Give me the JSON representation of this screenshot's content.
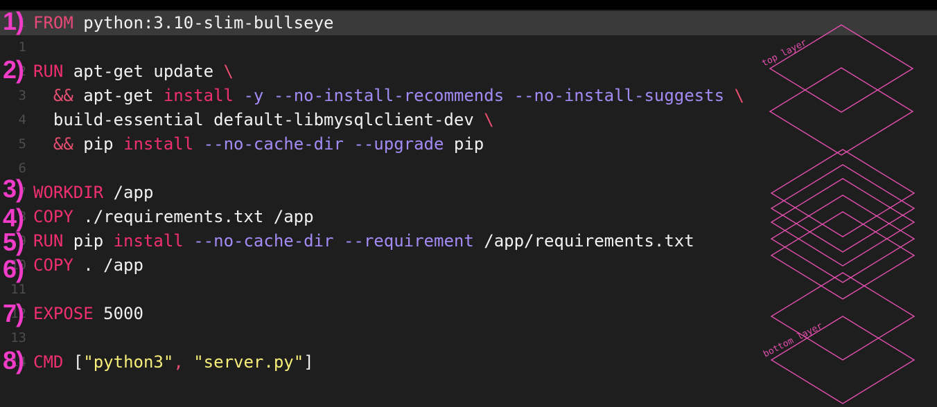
{
  "editor": {
    "lines": [
      {
        "num": "1",
        "tokens": [
          {
            "t": "FROM",
            "c": "kw-dim"
          },
          {
            "t": " python:3.10-slim-bullseye",
            "c": ""
          }
        ]
      },
      {
        "num": "1",
        "tokens": []
      },
      {
        "num": "2",
        "tokens": [
          {
            "t": "RUN",
            "c": "kw"
          },
          {
            "t": " apt-get update ",
            "c": ""
          },
          {
            "t": "\\",
            "c": "op"
          }
        ]
      },
      {
        "num": "3",
        "tokens": [
          {
            "t": "  ",
            "c": ""
          },
          {
            "t": "&&",
            "c": "op"
          },
          {
            "t": " apt-get ",
            "c": ""
          },
          {
            "t": "install",
            "c": "kw"
          },
          {
            "t": " ",
            "c": ""
          },
          {
            "t": "-y --no-install-recommends --no-install-suggests",
            "c": "flag"
          },
          {
            "t": " ",
            "c": ""
          },
          {
            "t": "\\",
            "c": "op"
          }
        ]
      },
      {
        "num": "4",
        "tokens": [
          {
            "t": "  build-essential default-libmysqlclient-dev ",
            "c": ""
          },
          {
            "t": "\\",
            "c": "op"
          }
        ]
      },
      {
        "num": "5",
        "tokens": [
          {
            "t": "  ",
            "c": ""
          },
          {
            "t": "&&",
            "c": "op"
          },
          {
            "t": " pip ",
            "c": ""
          },
          {
            "t": "install",
            "c": "kw"
          },
          {
            "t": " ",
            "c": ""
          },
          {
            "t": "--no-cache-dir --upgrade",
            "c": "flag"
          },
          {
            "t": " pip",
            "c": ""
          }
        ]
      },
      {
        "num": "6",
        "tokens": []
      },
      {
        "num": "7",
        "tokens": [
          {
            "t": "WORKDIR",
            "c": "kw"
          },
          {
            "t": " /app",
            "c": ""
          }
        ]
      },
      {
        "num": "8",
        "tokens": [
          {
            "t": "COPY",
            "c": "kw"
          },
          {
            "t": " ./requirements.txt /app",
            "c": ""
          }
        ]
      },
      {
        "num": "9",
        "tokens": [
          {
            "t": "RUN",
            "c": "kw"
          },
          {
            "t": " pip ",
            "c": ""
          },
          {
            "t": "install",
            "c": "kw"
          },
          {
            "t": " ",
            "c": ""
          },
          {
            "t": "--no-cache-dir --requirement",
            "c": "flag"
          },
          {
            "t": " /app/requirements.txt",
            "c": ""
          }
        ]
      },
      {
        "num": "10",
        "tokens": [
          {
            "t": "COPY",
            "c": "kw"
          },
          {
            "t": " . /app",
            "c": ""
          }
        ]
      },
      {
        "num": "11",
        "tokens": []
      },
      {
        "num": "12",
        "tokens": [
          {
            "t": "EXPOSE",
            "c": "kw"
          },
          {
            "t": " 5000",
            "c": ""
          }
        ]
      },
      {
        "num": "13",
        "tokens": []
      },
      {
        "num": "14",
        "tokens": [
          {
            "t": "CMD",
            "c": "kw"
          },
          {
            "t": " [",
            "c": ""
          },
          {
            "t": "\"python3\"",
            "c": "str"
          },
          {
            "t": ", ",
            "c": "op"
          },
          {
            "t": "\"server.py\"",
            "c": "str"
          },
          {
            "t": "]",
            "c": ""
          }
        ]
      }
    ]
  },
  "markers": [
    "1)",
    "2)",
    "3)",
    "4)",
    "5)",
    "6)",
    "7)",
    "8)"
  ],
  "annotation": {
    "top_label": "top layer",
    "bottom_label": "bottom layer",
    "color": "#e24fae"
  },
  "colors": {
    "background": "#1e1e1e",
    "current_line": "#3a3a3a",
    "keyword": "#f0306e",
    "flag": "#a38bf5",
    "string": "#f7ef7a",
    "marker": "#f13cc8"
  }
}
